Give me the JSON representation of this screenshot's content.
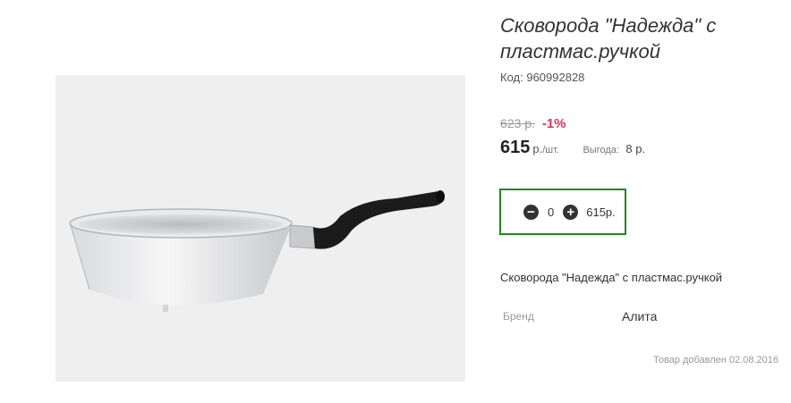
{
  "product": {
    "title": "Сковорода \"Надежда\" с пластмас.ручкой",
    "code_label": "Код:",
    "code": "960992828",
    "old_price": "623 р.",
    "discount": "-1%",
    "price": "615",
    "currency": "р.",
    "per_unit": "/шт.",
    "benefit_label": "Выгода:",
    "benefit_value": "8 р.",
    "description": "Сковорода \"Надежда\" с пластмас.ручкой",
    "brand_label": "Бренд",
    "brand_value": "Алита",
    "added_text": "Товар добавлен 02.08.2016"
  },
  "cart": {
    "minus_icon": "−",
    "plus_icon": "+",
    "quantity": "0",
    "total": "615р."
  },
  "colors": {
    "discount": "#e3305a",
    "cart_border": "#1f8a1f"
  }
}
